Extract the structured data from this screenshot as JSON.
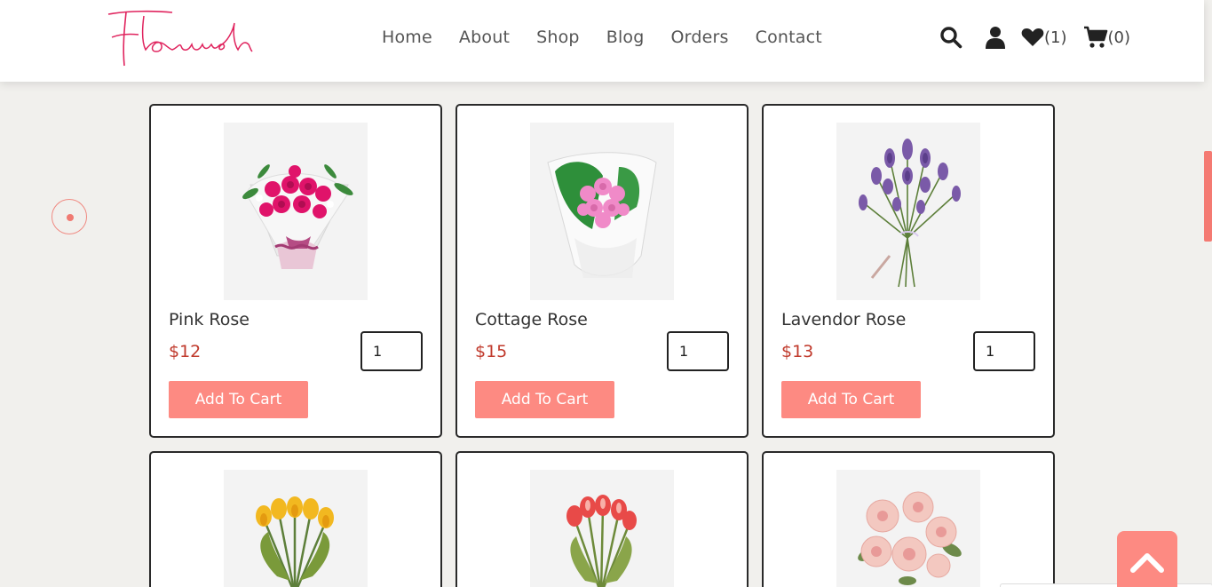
{
  "header": {
    "logo_text": "Flourish",
    "nav": [
      "Home",
      "About",
      "Shop",
      "Blog",
      "Orders",
      "Contact"
    ],
    "wishlist_count": "(1)",
    "cart_count": "(0)"
  },
  "colors": {
    "accent": "#fd8a82",
    "price": "#c0392b",
    "logo": "#e0245e"
  },
  "products": [
    {
      "name": "Pink Rose",
      "price": "$12",
      "qty": "1",
      "button": "Add To Cart",
      "image": "pink-rose-bouquet"
    },
    {
      "name": "Cottage Rose",
      "price": "$15",
      "qty": "1",
      "button": "Add To Cart",
      "image": "cottage-rose-bouquet"
    },
    {
      "name": "Lavendor Rose",
      "price": "$13",
      "qty": "1",
      "button": "Add To Cart",
      "image": "lavender-bouquet"
    },
    {
      "image": "yellow-tulips"
    },
    {
      "image": "red-tulips"
    },
    {
      "image": "peach-roses"
    }
  ],
  "icons": [
    "search-icon",
    "user-icon",
    "heart-icon",
    "cart-icon",
    "chevron-up-icon"
  ]
}
